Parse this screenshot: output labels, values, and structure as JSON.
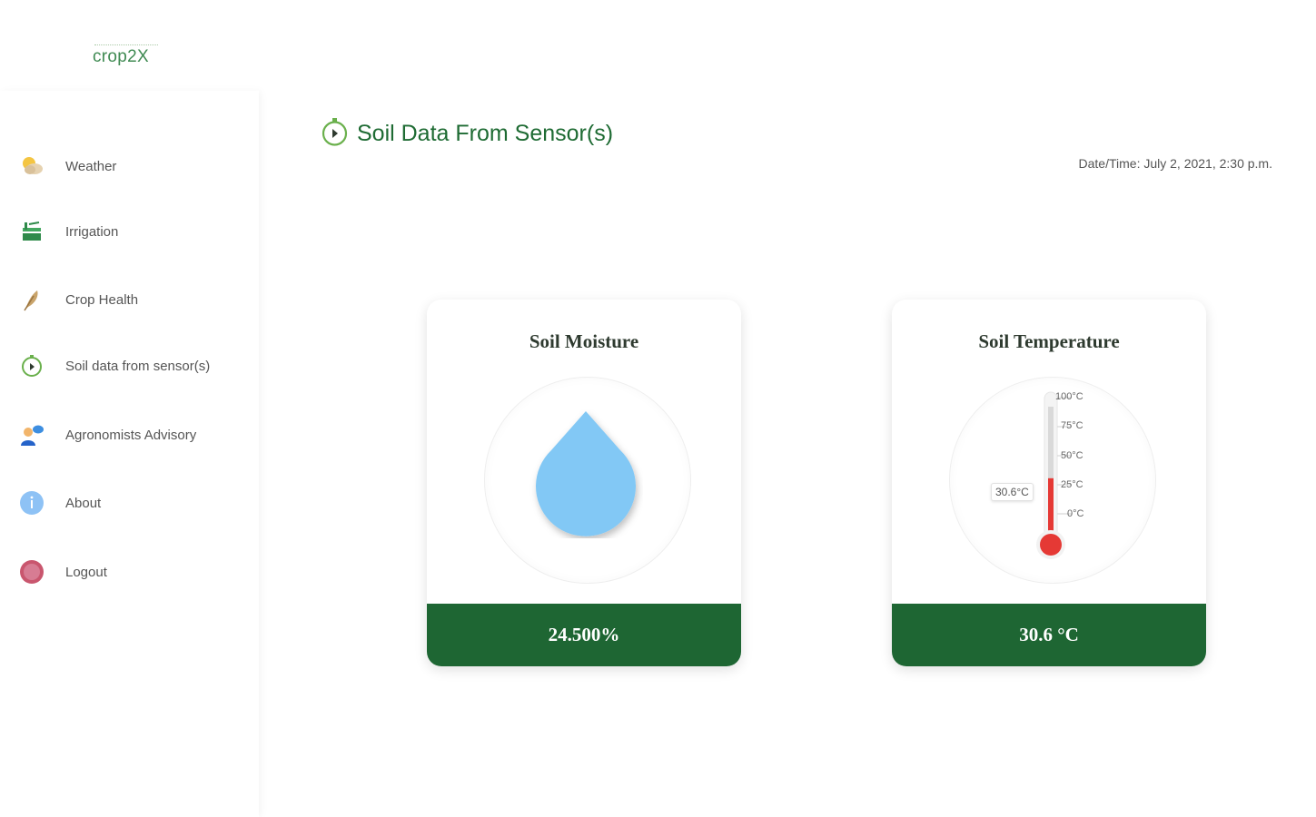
{
  "app": {
    "logo_text": "crop2X"
  },
  "sidebar": {
    "items": [
      {
        "label": "Weather",
        "icon": "weather-icon"
      },
      {
        "label": "Irrigation",
        "icon": "irrigation-icon"
      },
      {
        "label": "Crop Health",
        "icon": "crop-health-icon"
      },
      {
        "label": "Soil data from sensor(s)",
        "icon": "sensor-clock-icon"
      },
      {
        "label": "Agronomists Advisory",
        "icon": "advisor-icon"
      },
      {
        "label": "About",
        "icon": "info-icon"
      },
      {
        "label": "Logout",
        "icon": "logout-icon"
      }
    ]
  },
  "header": {
    "title": "Soil Data From Sensor(s)",
    "datetime": "Date/Time: July 2, 2021, 2:30 p.m."
  },
  "cards": {
    "moisture": {
      "title": "Soil Moisture",
      "value": "24.500%"
    },
    "temperature": {
      "title": "Soil Temperature",
      "value": "30.6 °C",
      "reading_label": "30.6°C",
      "reading_celsius": 30.6,
      "scale_labels": [
        "100°C",
        "75°C",
        "50°C",
        "25°C",
        "0°C"
      ]
    }
  },
  "colors": {
    "brand_green": "#1e6633",
    "title_green": "#1e6b33",
    "water_blue": "#82c8f5",
    "thermo_red": "#e53935"
  }
}
